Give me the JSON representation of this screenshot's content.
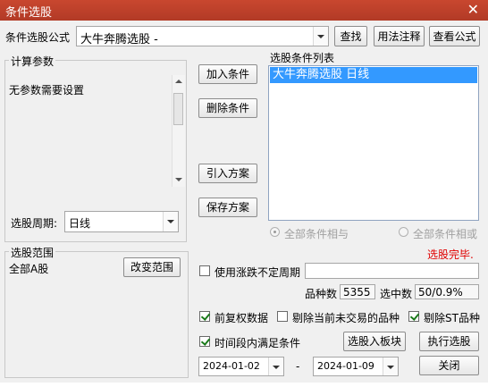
{
  "window": {
    "title": "条件选股",
    "close_glyph": "✕"
  },
  "formula": {
    "label": "条件选股公式",
    "value": "大牛奔腾选股 -",
    "buttons": {
      "find": "查找",
      "usage": "用法注释",
      "view": "查看公式"
    }
  },
  "params": {
    "group_label": "计算参数",
    "text": "无参数需要设置"
  },
  "period": {
    "label": "选股周期:",
    "value": "日线"
  },
  "condition_buttons": {
    "add": "加入条件",
    "delete": "删除条件",
    "import": "引入方案",
    "save": "保存方案"
  },
  "conditions": {
    "label": "选股条件列表",
    "items": [
      "大牛奔腾选股  日线"
    ]
  },
  "logic": {
    "and": "全部条件相与",
    "or": "全部条件相或"
  },
  "status": {
    "text": "选股完毕.",
    "color": "#e00000"
  },
  "range": {
    "group_label": "选股范围",
    "value": "全部A股",
    "button": "改变范围"
  },
  "stats": {
    "variable_period_label": "使用涨跌不定周期",
    "variety_label": "品种数",
    "variety_value": "5355",
    "selected_label": "选中数",
    "selected_value": "50/0.9%"
  },
  "options": {
    "forward_adjust": "前复权数据",
    "exclude_untraded": "剔除当前未交易的品种",
    "exclude_st": "剔除ST品种",
    "time_range": "时间段内满足条件"
  },
  "actions": {
    "add_to_block": "选股入板块",
    "execute": "执行选股",
    "close": "关闭"
  },
  "dates": {
    "start": "2024-01-02",
    "separator": "-",
    "end": "2024-01-09"
  }
}
